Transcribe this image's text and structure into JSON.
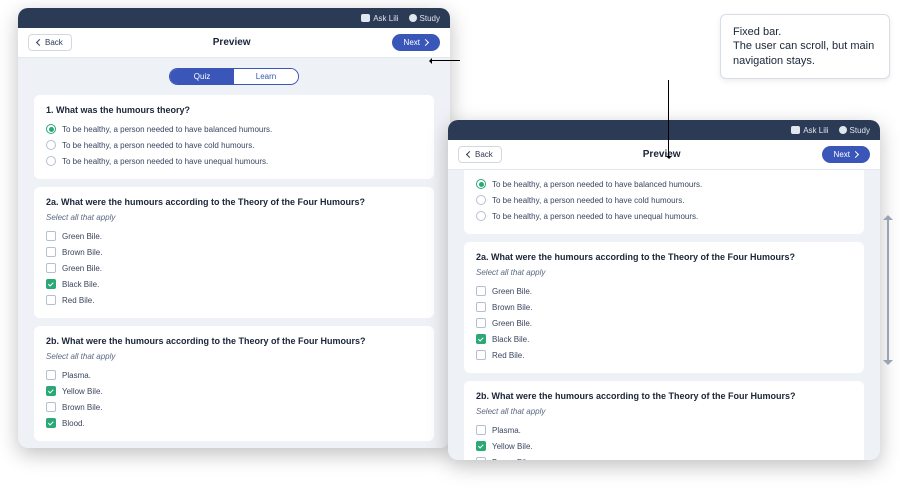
{
  "colors": {
    "brand": "#3a56b8",
    "topbar": "#2b3a55",
    "accent": "#2aa876"
  },
  "annotation": "Fixed bar.\nThe user can scroll, but main navigation stays.",
  "topnav": {
    "ask": "Ask Lili",
    "study": "Study"
  },
  "header": {
    "back": "Back",
    "title": "Preview",
    "next": "Next"
  },
  "toggle": {
    "quiz": "Quiz",
    "learn": "Learn"
  },
  "questions": [
    {
      "num": "1.",
      "text": "What was the humours theory?",
      "type": "radio",
      "options": [
        {
          "label": "To be healthy, a person needed to have balanced humours.",
          "selected": true
        },
        {
          "label": "To be healthy, a person needed to have cold humours.",
          "selected": false
        },
        {
          "label": "To be healthy, a person needed to have unequal humours.",
          "selected": false
        }
      ]
    },
    {
      "num": "2a.",
      "text": "What were the humours according to the Theory of the Four Humours?",
      "sub": "Select all that apply",
      "type": "check",
      "options": [
        {
          "label": "Green Bile.",
          "selected": false
        },
        {
          "label": "Brown Bile.",
          "selected": false
        },
        {
          "label": "Green Bile.",
          "selected": false
        },
        {
          "label": "Black Bile.",
          "selected": true
        },
        {
          "label": "Red Bile.",
          "selected": false
        }
      ]
    },
    {
      "num": "2b.",
      "text": "What were the humours according to the Theory of the Four Humours?",
      "sub": "Select all that apply",
      "type": "check",
      "options": [
        {
          "label": "Plasma.",
          "selected": false
        },
        {
          "label": "Yellow Bile.",
          "selected": true
        },
        {
          "label": "Brown Bile.",
          "selected": false
        },
        {
          "label": "Blood.",
          "selected": true
        }
      ]
    }
  ]
}
